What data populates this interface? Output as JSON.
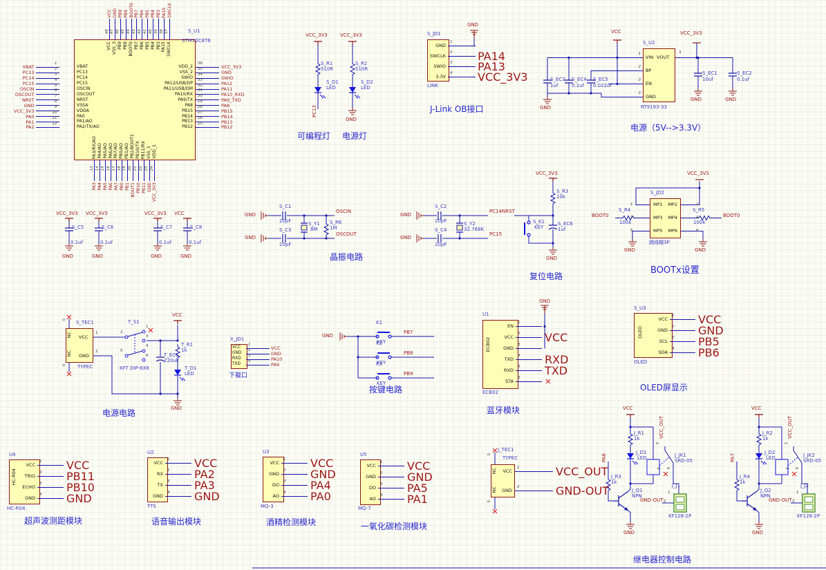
{
  "n": {
    "gnd": "GND",
    "vcc": "VCC",
    "vcc33": "VCC_3V3",
    "vccout": "VCC_OUT",
    "gndout": "GND-OUT",
    "nrst": "NRST",
    "boot0": "BOOT0",
    "nc": "NC",
    "zero": "0"
  },
  "mcu": {
    "ref": "S_U1",
    "part": "STM32C8T6",
    "left": [
      {
        "num": "1",
        "name": "VBAT",
        "net": "VBAT"
      },
      {
        "num": "2",
        "name": "PC13",
        "net": "PC13"
      },
      {
        "num": "3",
        "name": "PC14",
        "net": "PC14"
      },
      {
        "num": "4",
        "name": "PC15",
        "net": "PC15"
      },
      {
        "num": "5",
        "name": "OSCIN",
        "net": "OSCIN"
      },
      {
        "num": "6",
        "name": "OSCOUT",
        "net": "OSCOUT"
      },
      {
        "num": "7",
        "name": "NRST",
        "net": "NRST"
      },
      {
        "num": "8",
        "name": "VSSA",
        "net": "GND"
      },
      {
        "num": "9",
        "name": "VDDA",
        "net": "VCC_3V3"
      },
      {
        "num": "10",
        "name": "PA0",
        "net": "PA0"
      },
      {
        "num": "11",
        "name": "PA1/AO",
        "net": "PA1"
      },
      {
        "num": "12",
        "name": "PA2/TX/AO",
        "net": "PA2"
      }
    ],
    "top": [
      {
        "num": "48",
        "name": "VCC",
        "net": "VCC"
      },
      {
        "num": "47",
        "name": "VSS_3",
        "net": "GND"
      },
      {
        "num": "46",
        "name": "PB9",
        "net": "PB9"
      },
      {
        "num": "45",
        "name": "PB8",
        "net": "PB8"
      },
      {
        "num": "44",
        "name": "BOOT0",
        "net": "BOOT0"
      },
      {
        "num": "43",
        "name": "PB7",
        "net": "PB7"
      },
      {
        "num": "42",
        "name": "PB6",
        "net": "PB6"
      },
      {
        "num": "41",
        "name": "PB5",
        "net": "PB5"
      },
      {
        "num": "40",
        "name": "PB4",
        "net": "PB4"
      },
      {
        "num": "39",
        "name": "PB3",
        "net": "PB3"
      },
      {
        "num": "38",
        "name": "PA15",
        "net": "PA15"
      },
      {
        "num": "37",
        "name": "SWCLK",
        "net": "SWCLK"
      }
    ],
    "right": [
      {
        "num": "36",
        "name": "VDD_2",
        "net": "VCC_3V3"
      },
      {
        "num": "35",
        "name": "VSS_2",
        "net": "GND"
      },
      {
        "num": "34",
        "name": "SWIO",
        "net": "SWIO"
      },
      {
        "num": "33",
        "name": "PA12/USB/DP",
        "net": "PA12"
      },
      {
        "num": "32",
        "name": "PA11/USB/DM",
        "net": "PA11"
      },
      {
        "num": "31",
        "name": "PA10/RX",
        "net": "PA10_RXD"
      },
      {
        "num": "30",
        "name": "PA9/TX",
        "net": "PA9_TXD"
      },
      {
        "num": "29",
        "name": "PA8",
        "net": "PA8"
      },
      {
        "num": "28",
        "name": "PB15",
        "net": "PB15"
      },
      {
        "num": "27",
        "name": "PB14",
        "net": "PB14"
      },
      {
        "num": "26",
        "name": "PB13",
        "net": "PB13"
      },
      {
        "num": "25",
        "name": "PB12",
        "net": "PB12"
      }
    ],
    "bottom": [
      {
        "num": "13",
        "name": "PA3/RX/AO",
        "net": "PA3"
      },
      {
        "num": "14",
        "name": "PA4/AO",
        "net": "PA4"
      },
      {
        "num": "15",
        "name": "PA5/AO",
        "net": "PA5"
      },
      {
        "num": "16",
        "name": "PA6/AO",
        "net": "PA6"
      },
      {
        "num": "17",
        "name": "PA7/AO",
        "net": "PA7"
      },
      {
        "num": "18",
        "name": "PB0/AO",
        "net": "PB0"
      },
      {
        "num": "19",
        "name": "PB1/AO",
        "net": "PB1"
      },
      {
        "num": "20",
        "name": "PB2/BOOT1",
        "net": "BOOT1"
      },
      {
        "num": "21",
        "name": "PB10/TX",
        "net": "PB10"
      },
      {
        "num": "22",
        "name": "PB11/RX",
        "net": "PB11"
      },
      {
        "num": "23",
        "name": "VSS_1",
        "net": "GND"
      },
      {
        "num": "24",
        "name": "VDD_1",
        "net": "VCC_3V3"
      }
    ]
  },
  "caps_row": {
    "pair1": [
      {
        "pwr": "VCC_3V3",
        "ref": "S_C5",
        "val": "0.1uf",
        "gnd": "GND"
      },
      {
        "pwr": "VCC_3V3",
        "ref": "S_C6",
        "val": "0.1uf",
        "gnd": "GND"
      }
    ],
    "pair2": [
      {
        "pwr": "VCC_3V3",
        "ref": "S_C7",
        "val": "0.1uf",
        "gnd": "GND"
      },
      {
        "pwr": "VCC",
        "ref": "S_C8",
        "val": "0.1uf",
        "gnd": "GND"
      }
    ]
  },
  "leds": {
    "u1": {
      "pwr": "VCC_3V3",
      "rref": "S_R1",
      "rval": "510R",
      "dref": "S_D1",
      "dval": "LED",
      "net": "PC13",
      "title": "可编程灯"
    },
    "u2": {
      "pwr": "VCC_3V3",
      "rref": "S_R2",
      "rval": "510R",
      "dref": "S_D2",
      "dval": "LED",
      "net": "GND",
      "title": "电源灯"
    }
  },
  "jlink": {
    "ref": "S_JD1",
    "part": "LINK",
    "title": "J-Link OB接口",
    "gnd": "GND",
    "pins": [
      {
        "num": "1",
        "name": "GND",
        "net": ""
      },
      {
        "num": "2",
        "name": "SWCLK",
        "net": "PA14"
      },
      {
        "num": "3",
        "name": "SWIO",
        "net": "PA13"
      },
      {
        "num": "4",
        "name": "3.3V",
        "net": "VCC_3V3"
      }
    ]
  },
  "reg": {
    "ref": "S_U2",
    "part": "RT9193-33",
    "title": "电源（5V-->3.3V）",
    "vout_name": "VOUT",
    "vout_num": "3",
    "pins": [
      {
        "num": "1",
        "name": "VIN"
      },
      {
        "num": "2",
        "name": "BP"
      },
      {
        "num": "3",
        "name": "EN"
      },
      {
        "num": "3",
        "name": "GND"
      }
    ],
    "caps_in": [
      {
        "ref": "S_EC3",
        "val": "1uf"
      },
      {
        "ref": "S_EC4",
        "val": "0.1uf"
      },
      {
        "ref": "S_EC5",
        "val": "0.022uf"
      }
    ],
    "caps_out": [
      {
        "ref": "S_EC1",
        "val": "10uf"
      },
      {
        "ref": "S_EC2",
        "val": "0.1uf"
      }
    ]
  },
  "xtal": {
    "title": "晶振电路",
    "g1": {
      "c1": "S_C1",
      "v1": "20pF",
      "c2": "S_C3",
      "v2": "20pF",
      "y": "S_Y1",
      "yv": "8M",
      "r": "S_R6",
      "rv": "1M",
      "nt": "OSCIN",
      "nb": "OSCOUT"
    },
    "g2": {
      "c1": "S_C2",
      "v1": "20pF",
      "c2": "S_C4",
      "v2": "20pF",
      "y": "S_Y2",
      "yv": "32.768K",
      "nt": "PC14",
      "nb": "PC15"
    }
  },
  "reset": {
    "title": "复位电路",
    "rref": "S_R3",
    "rval": "10k",
    "kref": "S_K1",
    "kval": "KEY",
    "cref": "S_EC6",
    "cval": "1uf"
  },
  "bootx": {
    "title": "BOOTx设置",
    "ref": "S_JD2",
    "part": "跳线帽3P",
    "rows": [
      {
        "ln": "1",
        "l": "MP1",
        "r": "MP2",
        "rn": "2"
      },
      {
        "ln": "3",
        "l": "MP3",
        "r": "MP4",
        "rn": "4"
      },
      {
        "ln": "5",
        "l": "MP5",
        "r": "MP6",
        "rn": "6"
      }
    ],
    "r4": "S_R4",
    "r4v": "100k",
    "r5": "S_R5",
    "r5v": "100k",
    "net_l": "BOOT0",
    "net_r": "BOOT0"
  },
  "pwrckt": {
    "title": "电源电路",
    "ref": "S_TEC1",
    "part": "TYPEC",
    "p1": "1",
    "p2": "2",
    "vcc": "VCC",
    "gnd": "GND",
    "sw": {
      "ref": "T_S1",
      "part": "KFT DIP-8X8",
      "nums": [
        "1",
        "2",
        "3",
        "4",
        "5",
        "6"
      ]
    },
    "rref": "T_R1",
    "rval": "1k",
    "cref": "T_EC1",
    "cval": "220uF",
    "dref": "T_D1",
    "dval": "LED"
  },
  "dl": {
    "ref": "X_JD1",
    "title": "下载口",
    "pins": [
      {
        "num": "1",
        "name": "VCC",
        "net": "VCC"
      },
      {
        "num": "2",
        "name": "GND",
        "net": "GND"
      },
      {
        "num": "3",
        "name": "RXD",
        "net": "PA10"
      },
      {
        "num": "4",
        "name": "TXD",
        "net": "PA9"
      }
    ]
  },
  "keys": {
    "title": "按键电路",
    "gnd": "GND",
    "items": [
      {
        "ref": "K1",
        "val": "KEY",
        "net": "PB7"
      },
      {
        "ref": "K2",
        "val": "KEY",
        "net": "PB8"
      },
      {
        "ref": "K3",
        "val": "KEY",
        "net": "PB9"
      }
    ]
  },
  "bt": {
    "ref": "U1",
    "part": "ECB02",
    "inner": "ECB02",
    "title": "蓝牙模块",
    "gnd": "GND",
    "pins": [
      {
        "num": "1",
        "name": "EN",
        "net": ""
      },
      {
        "num": "2",
        "name": "VCC",
        "net": "VCC"
      },
      {
        "num": "3",
        "name": "GND",
        "net": ""
      },
      {
        "num": "4",
        "name": "TXD",
        "net": "RXD"
      },
      {
        "num": "5",
        "name": "RXD",
        "net": "TXD"
      },
      {
        "num": "6",
        "name": "STA",
        "net": ""
      }
    ]
  },
  "oled": {
    "ref": "S_U3",
    "part": "OLED",
    "inner": "OLED",
    "title": "OLED屏显示",
    "pins": [
      {
        "num": "1",
        "name": "VCC",
        "net": "VCC"
      },
      {
        "num": "2",
        "name": "GND",
        "net": "GND"
      },
      {
        "num": "3",
        "name": "SCL",
        "net": "PB5"
      },
      {
        "num": "4",
        "name": "SDA",
        "net": "PB6"
      }
    ]
  },
  "ultra": {
    "ref": "U4",
    "part": "HC-R04",
    "inner": "HC-R04",
    "title": "超声波测距模块",
    "pins": [
      {
        "num": "1",
        "name": "VCC",
        "net": "VCC"
      },
      {
        "num": "2",
        "name": "TRIG",
        "net": "PB11"
      },
      {
        "num": "3",
        "name": "ECHO",
        "net": "PB10"
      },
      {
        "num": "4",
        "name": "GND",
        "net": "GND"
      }
    ]
  },
  "voice": {
    "ref": "U2",
    "part": "TTS",
    "title": "语音输出模块",
    "pins": [
      {
        "num": "1",
        "name": "VCC",
        "net": "VCC"
      },
      {
        "num": "2",
        "name": "RX",
        "net": "PA2"
      },
      {
        "num": "3",
        "name": "TX",
        "net": "PA3"
      },
      {
        "num": "4",
        "name": "GND",
        "net": "GND"
      }
    ]
  },
  "mq3": {
    "ref": "U3",
    "part": "MQ-3",
    "title": "酒精检测模块",
    "pins": [
      {
        "num": "1",
        "name": "VCC",
        "net": "VCC"
      },
      {
        "num": "2",
        "name": "GND",
        "net": "GND"
      },
      {
        "num": "3",
        "name": "DO",
        "net": "PA4"
      },
      {
        "num": "4",
        "name": "AO",
        "net": "PA0"
      }
    ]
  },
  "mq7": {
    "ref": "U5",
    "part": "MQ-7",
    "title": "一氧化碳检测模块",
    "pins": [
      {
        "num": "1",
        "name": "VCC",
        "net": "VCC"
      },
      {
        "num": "2",
        "name": "GND",
        "net": "GND"
      },
      {
        "num": "3",
        "name": "DO",
        "net": "PA5"
      },
      {
        "num": "4",
        "name": "AO",
        "net": "PA1"
      }
    ]
  },
  "jtec": {
    "ref": "J_TEC1",
    "part": "TYPEC",
    "pins": [
      {
        "num": "1",
        "name": "VCC",
        "net": "VCC_OUT"
      },
      {
        "num": "2",
        "name": "GND",
        "net": "GND-OUT"
      }
    ]
  },
  "relay": {
    "title": "继电器控制电路",
    "a": {
      "rt": "J_R1",
      "rtv": "1k",
      "d": "J_D1",
      "dv": "LED",
      "jk": "J_JK1",
      "jkv": "SRD-05",
      "in": "PA6",
      "rb": "J_R3",
      "rbv": "1k",
      "q": "J_Q1",
      "qv": "NPN",
      "j": "J_J1",
      "jp": "KF128-2P",
      "p1": "1",
      "p2": "2",
      "jknums": [
        "3",
        "5",
        "4"
      ]
    },
    "b": {
      "rt": "J_R2",
      "rtv": "1k",
      "d": "J_D2",
      "dv": "LED",
      "jk": "J_JK2",
      "jkv": "SRD-05",
      "in": "PA7",
      "rb": "J_R4",
      "rbv": "1k",
      "q": "J_Q2",
      "qv": "NPN",
      "j": "J_J2",
      "jp": "KF128-2P",
      "p1": "1",
      "p2": "2",
      "jknums": [
        "3",
        "5",
        "4"
      ]
    }
  }
}
